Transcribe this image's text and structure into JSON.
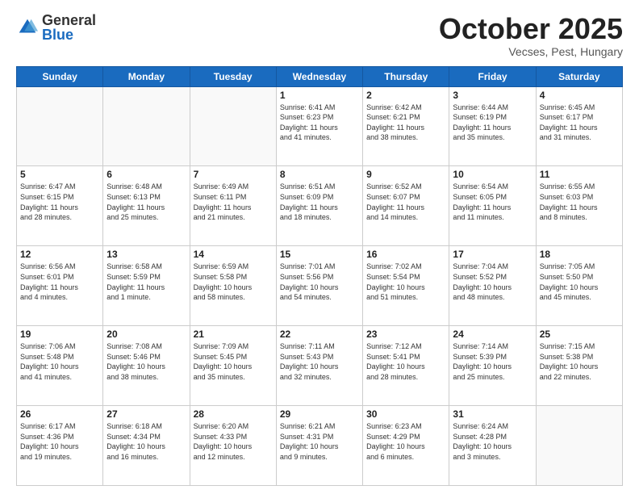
{
  "header": {
    "logo_general": "General",
    "logo_blue": "Blue",
    "title": "October 2025",
    "location": "Vecses, Pest, Hungary"
  },
  "days_of_week": [
    "Sunday",
    "Monday",
    "Tuesday",
    "Wednesday",
    "Thursday",
    "Friday",
    "Saturday"
  ],
  "weeks": [
    [
      {
        "day": "",
        "info": ""
      },
      {
        "day": "",
        "info": ""
      },
      {
        "day": "",
        "info": ""
      },
      {
        "day": "1",
        "info": "Sunrise: 6:41 AM\nSunset: 6:23 PM\nDaylight: 11 hours\nand 41 minutes."
      },
      {
        "day": "2",
        "info": "Sunrise: 6:42 AM\nSunset: 6:21 PM\nDaylight: 11 hours\nand 38 minutes."
      },
      {
        "day": "3",
        "info": "Sunrise: 6:44 AM\nSunset: 6:19 PM\nDaylight: 11 hours\nand 35 minutes."
      },
      {
        "day": "4",
        "info": "Sunrise: 6:45 AM\nSunset: 6:17 PM\nDaylight: 11 hours\nand 31 minutes."
      }
    ],
    [
      {
        "day": "5",
        "info": "Sunrise: 6:47 AM\nSunset: 6:15 PM\nDaylight: 11 hours\nand 28 minutes."
      },
      {
        "day": "6",
        "info": "Sunrise: 6:48 AM\nSunset: 6:13 PM\nDaylight: 11 hours\nand 25 minutes."
      },
      {
        "day": "7",
        "info": "Sunrise: 6:49 AM\nSunset: 6:11 PM\nDaylight: 11 hours\nand 21 minutes."
      },
      {
        "day": "8",
        "info": "Sunrise: 6:51 AM\nSunset: 6:09 PM\nDaylight: 11 hours\nand 18 minutes."
      },
      {
        "day": "9",
        "info": "Sunrise: 6:52 AM\nSunset: 6:07 PM\nDaylight: 11 hours\nand 14 minutes."
      },
      {
        "day": "10",
        "info": "Sunrise: 6:54 AM\nSunset: 6:05 PM\nDaylight: 11 hours\nand 11 minutes."
      },
      {
        "day": "11",
        "info": "Sunrise: 6:55 AM\nSunset: 6:03 PM\nDaylight: 11 hours\nand 8 minutes."
      }
    ],
    [
      {
        "day": "12",
        "info": "Sunrise: 6:56 AM\nSunset: 6:01 PM\nDaylight: 11 hours\nand 4 minutes."
      },
      {
        "day": "13",
        "info": "Sunrise: 6:58 AM\nSunset: 5:59 PM\nDaylight: 11 hours\nand 1 minute."
      },
      {
        "day": "14",
        "info": "Sunrise: 6:59 AM\nSunset: 5:58 PM\nDaylight: 10 hours\nand 58 minutes."
      },
      {
        "day": "15",
        "info": "Sunrise: 7:01 AM\nSunset: 5:56 PM\nDaylight: 10 hours\nand 54 minutes."
      },
      {
        "day": "16",
        "info": "Sunrise: 7:02 AM\nSunset: 5:54 PM\nDaylight: 10 hours\nand 51 minutes."
      },
      {
        "day": "17",
        "info": "Sunrise: 7:04 AM\nSunset: 5:52 PM\nDaylight: 10 hours\nand 48 minutes."
      },
      {
        "day": "18",
        "info": "Sunrise: 7:05 AM\nSunset: 5:50 PM\nDaylight: 10 hours\nand 45 minutes."
      }
    ],
    [
      {
        "day": "19",
        "info": "Sunrise: 7:06 AM\nSunset: 5:48 PM\nDaylight: 10 hours\nand 41 minutes."
      },
      {
        "day": "20",
        "info": "Sunrise: 7:08 AM\nSunset: 5:46 PM\nDaylight: 10 hours\nand 38 minutes."
      },
      {
        "day": "21",
        "info": "Sunrise: 7:09 AM\nSunset: 5:45 PM\nDaylight: 10 hours\nand 35 minutes."
      },
      {
        "day": "22",
        "info": "Sunrise: 7:11 AM\nSunset: 5:43 PM\nDaylight: 10 hours\nand 32 minutes."
      },
      {
        "day": "23",
        "info": "Sunrise: 7:12 AM\nSunset: 5:41 PM\nDaylight: 10 hours\nand 28 minutes."
      },
      {
        "day": "24",
        "info": "Sunrise: 7:14 AM\nSunset: 5:39 PM\nDaylight: 10 hours\nand 25 minutes."
      },
      {
        "day": "25",
        "info": "Sunrise: 7:15 AM\nSunset: 5:38 PM\nDaylight: 10 hours\nand 22 minutes."
      }
    ],
    [
      {
        "day": "26",
        "info": "Sunrise: 6:17 AM\nSunset: 4:36 PM\nDaylight: 10 hours\nand 19 minutes."
      },
      {
        "day": "27",
        "info": "Sunrise: 6:18 AM\nSunset: 4:34 PM\nDaylight: 10 hours\nand 16 minutes."
      },
      {
        "day": "28",
        "info": "Sunrise: 6:20 AM\nSunset: 4:33 PM\nDaylight: 10 hours\nand 12 minutes."
      },
      {
        "day": "29",
        "info": "Sunrise: 6:21 AM\nSunset: 4:31 PM\nDaylight: 10 hours\nand 9 minutes."
      },
      {
        "day": "30",
        "info": "Sunrise: 6:23 AM\nSunset: 4:29 PM\nDaylight: 10 hours\nand 6 minutes."
      },
      {
        "day": "31",
        "info": "Sunrise: 6:24 AM\nSunset: 4:28 PM\nDaylight: 10 hours\nand 3 minutes."
      },
      {
        "day": "",
        "info": ""
      }
    ]
  ]
}
